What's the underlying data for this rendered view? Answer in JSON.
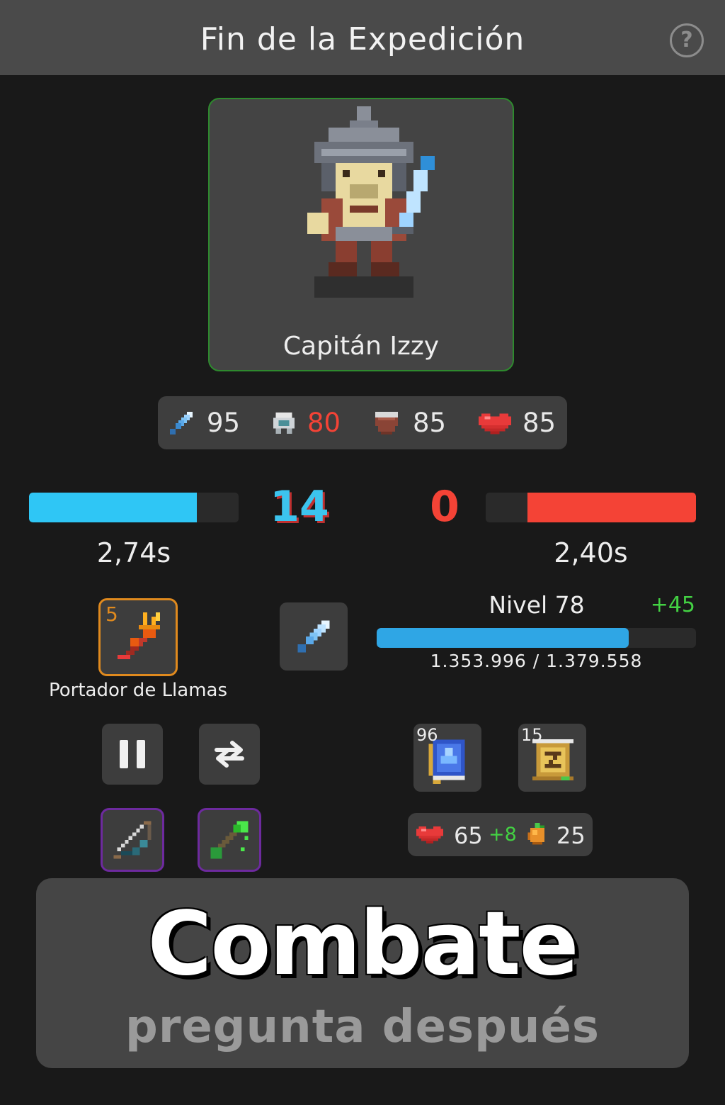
{
  "header": {
    "title": "Fin de la Expedición",
    "help_label": "?"
  },
  "hero": {
    "name": "Capitán Izzy"
  },
  "stats": {
    "attack": {
      "icon": "sword-icon",
      "value": "95"
    },
    "armor": {
      "icon": "helmet-icon",
      "value": "80",
      "color": "#f44336"
    },
    "shield": {
      "icon": "shield-icon",
      "value": "85"
    },
    "health": {
      "icon": "heart-icon",
      "value": "85"
    }
  },
  "combat": {
    "left_score": "14",
    "right_score": "0",
    "left_time": "2,74s",
    "right_time": "2,40s",
    "left_progress": 0.8,
    "right_progress": 0.8
  },
  "ability": {
    "count": "5",
    "label": "Portador de Llamas",
    "icon": "flame-trident-icon"
  },
  "level": {
    "label": "Nivel 78",
    "gain": "+45",
    "xp_text": "1.353.996 / 1.379.558",
    "xp_current": 1353996,
    "xp_max": 1379558
  },
  "items": {
    "book": {
      "count": "96",
      "icon": "spellbook-icon"
    },
    "scroll": {
      "count": "15",
      "icon": "scroll-icon"
    }
  },
  "resources": {
    "health": "65",
    "health_gain": "+8",
    "food": "25"
  },
  "banner": {
    "title": "Combate",
    "subtitle": "pregunta después"
  },
  "colors": {
    "accent_blue": "#2fc6f5",
    "enemy_red": "#f44336",
    "gain_green": "#43d143",
    "ability_orange": "#e08a1e",
    "rare_purple": "#6d2a9e"
  }
}
